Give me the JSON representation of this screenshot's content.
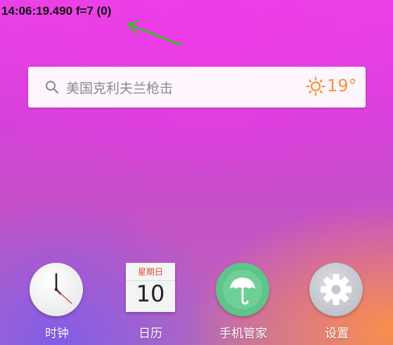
{
  "debug_overlay": {
    "text": "14:06:19.490 f=7 (0)"
  },
  "search_widget": {
    "query": "美国克利夫兰枪击",
    "search_icon": "search-icon",
    "weather_icon": "sun-icon",
    "temperature": "19°"
  },
  "dock": {
    "items": [
      {
        "label": "时钟",
        "icon": "clock-icon"
      },
      {
        "label": "日历",
        "icon": "calendar-icon",
        "weekday": "星期日",
        "day": "10"
      },
      {
        "label": "手机管家",
        "icon": "umbrella-icon"
      },
      {
        "label": "设置",
        "icon": "gear-icon"
      }
    ]
  },
  "colors": {
    "weather_accent": "#f39436",
    "annotation_arrow": "#3bb82a",
    "phone_manager_green": "#5fc489",
    "settings_gray": "#c7cbd1"
  }
}
